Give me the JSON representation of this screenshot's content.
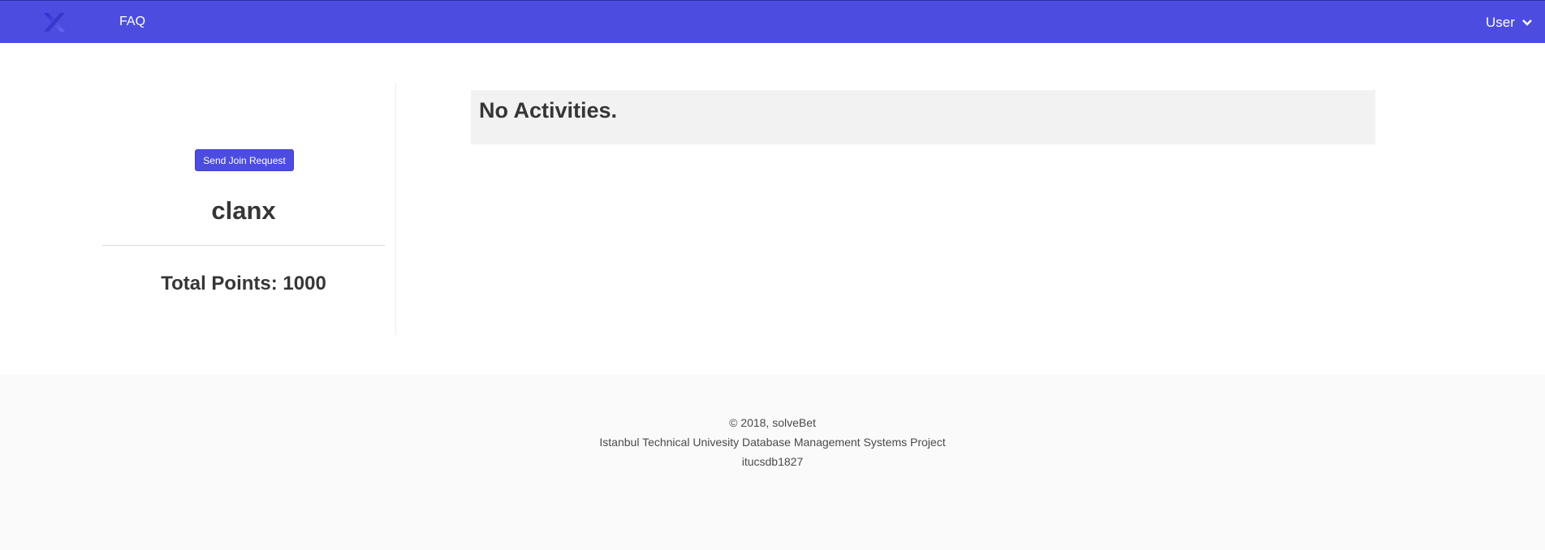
{
  "navbar": {
    "faq_label": "FAQ",
    "user_label": "User",
    "color": "#4c4de0"
  },
  "sidebar": {
    "join_button": "Send Join Request",
    "clan_name": "clanx",
    "total_points": "Total Points: 1000"
  },
  "main": {
    "activities_text": "No Activities."
  },
  "footer": {
    "copyright": "© 2018, solveBet",
    "project": "Istanbul Technical Univesity Database Management Systems Project",
    "repo": "itucsdb1827"
  }
}
